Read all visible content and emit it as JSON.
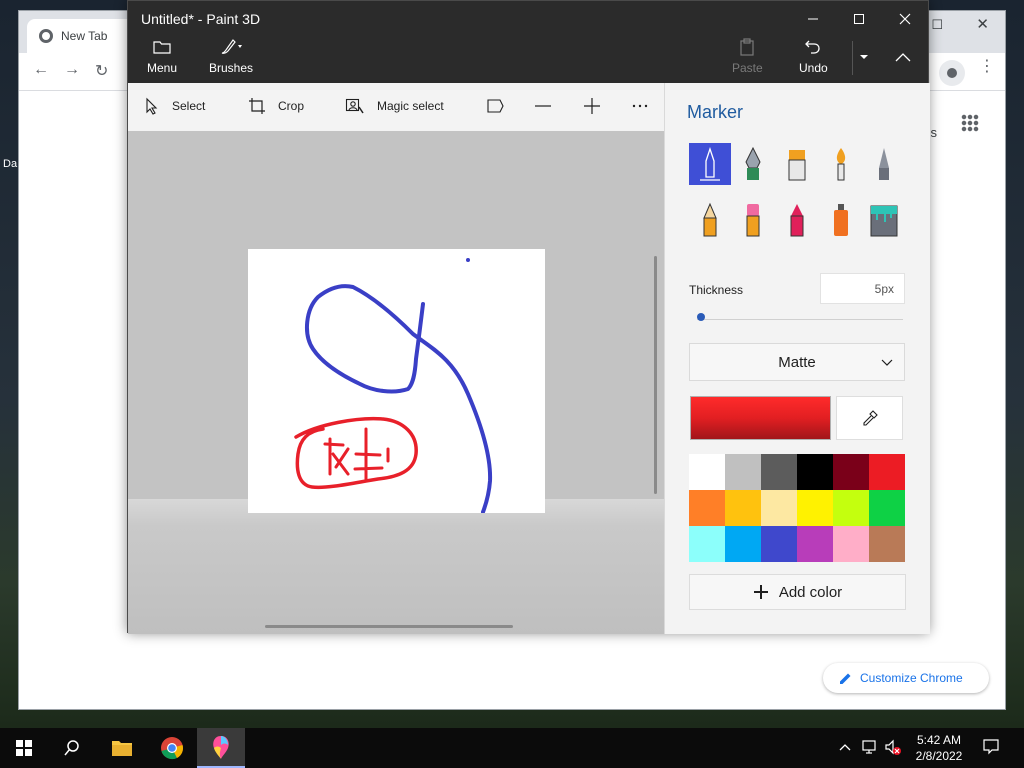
{
  "desktop": {
    "label": "Da"
  },
  "chrome": {
    "tab_title": "New Tab",
    "right_text": "es",
    "customize_label": "Customize Chrome"
  },
  "paint": {
    "title": "Untitled* - Paint 3D",
    "titlebar_buttons": {
      "menu": "Menu",
      "brushes": "Brushes",
      "paste": "Paste",
      "undo": "Undo"
    },
    "toolbar": {
      "select": "Select",
      "crop": "Crop",
      "magic_select": "Magic select"
    },
    "panel": {
      "title": "Marker",
      "brushes": [
        {
          "name": "marker",
          "color": "#ffffff",
          "selected": true
        },
        {
          "name": "calligraphy-pen",
          "color": "#2e8b57"
        },
        {
          "name": "oil-brush",
          "color": "#f0a020"
        },
        {
          "name": "watercolor",
          "color": "#f0a020"
        },
        {
          "name": "pixel-pen",
          "color": "#6a6f7a"
        },
        {
          "name": "pencil",
          "color": "#f0a020"
        },
        {
          "name": "eraser",
          "color": "#f06aa0"
        },
        {
          "name": "crayon",
          "color": "#e0205a"
        },
        {
          "name": "spray-can",
          "color": "#f07020"
        },
        {
          "name": "fill-bucket",
          "color": "#2ec4b6"
        }
      ],
      "thickness_label": "Thickness",
      "thickness_value": "5px",
      "thickness_fraction": 0.02,
      "finish_label": "Matte",
      "current_color": "#e21f22",
      "palette": [
        "#ffffff",
        "#c0c0c0",
        "#5c5c5c",
        "#000000",
        "#7a0019",
        "#ec1c24",
        "#ff7f27",
        "#ffc20e",
        "#fde8a2",
        "#fff200",
        "#c4ff0e",
        "#0ed145",
        "#8cfffb",
        "#00a8f3",
        "#3f48cc",
        "#b83dba",
        "#ffaec8",
        "#b97a57"
      ],
      "add_color_label": "Add color"
    }
  },
  "taskbar": {
    "time": "5:42 AM",
    "date": "2/8/2022"
  }
}
